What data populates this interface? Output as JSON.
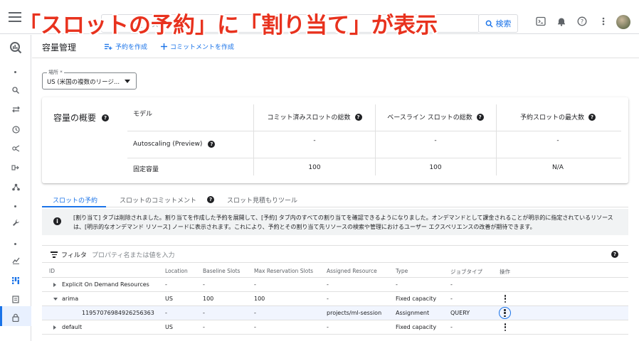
{
  "banner": "「スロットの予約」に「割り当て」が表示",
  "topbar": {
    "search_placeholder": "ッシ       を使      ースド、ロタ",
    "search_button": "検索",
    "icons": [
      "terminal-icon",
      "bell-icon",
      "help-icon",
      "more-vert-icon"
    ]
  },
  "header": {
    "title": "容量管理",
    "create_reservation": "予約を作成",
    "create_commitment": "コミットメントを作成"
  },
  "location": {
    "label": "場所 *",
    "value": "US (米国の複数のリージ..."
  },
  "overview": {
    "title": "容量の概要",
    "col_model": "モデル",
    "col_committed": "コミット済みスロットの総数",
    "col_baseline": "ベースライン スロットの総数",
    "col_max": "予約スロットの最大数",
    "rows": [
      {
        "model": "Autoscaling (Preview)",
        "committed": "-",
        "baseline": "-",
        "max": "-"
      },
      {
        "model": "固定容量",
        "committed": "100",
        "baseline": "100",
        "max": "N/A"
      }
    ]
  },
  "tabs": {
    "reservations": "スロットの予約",
    "commitments": "スロットのコミットメント",
    "estimator": "スロット見積もりツール"
  },
  "info": {
    "text": "[割り当て] タブは削除されました。割り当てを作成した予約を展開して、[予約] タブ内のすべての割り当てを確認できるようになりました。オンデマンドとして課金されることが明示的に指定されているリソースは、[明示的なオンデマンド リソース] ノードに表示されます。これにより、予約とその割り当て先リソースの検索や管理におけるユーザー エクスペリエンスの改善が期待できます。"
  },
  "filter": {
    "label": "フィルタ",
    "placeholder": "プロパティ名または値を入力"
  },
  "table": {
    "headers": {
      "id": "ID",
      "location": "Location",
      "baseline": "Baseline Slots",
      "max": "Max Reservation Slots",
      "assigned": "Assigned Resource",
      "type": "Type",
      "job_type": "ジョブタイプ",
      "actions": "操作"
    },
    "rows": [
      {
        "id": "Explicit On Demand Resources",
        "location": "-",
        "baseline": "-",
        "max": "-",
        "assigned": "-",
        "type": "-",
        "job_type": "-",
        "expand": "collapsed",
        "kebab": false
      },
      {
        "id": "arima",
        "location": "US",
        "baseline": "100",
        "max": "100",
        "assigned": "-",
        "type": "Fixed capacity",
        "job_type": "-",
        "expand": "expanded",
        "kebab": true
      },
      {
        "id": "11957076984926256363",
        "location": "-",
        "baseline": "-",
        "max": "-",
        "assigned": "projects/ml-session",
        "type": "Assignment",
        "job_type": "QUERY",
        "expand": "none",
        "kebab": true
      },
      {
        "id": "default",
        "location": "US",
        "baseline": "-",
        "max": "-",
        "assigned": "-",
        "type": "Fixed capacity",
        "job_type": "-",
        "expand": "collapsed",
        "kebab": true
      }
    ]
  }
}
